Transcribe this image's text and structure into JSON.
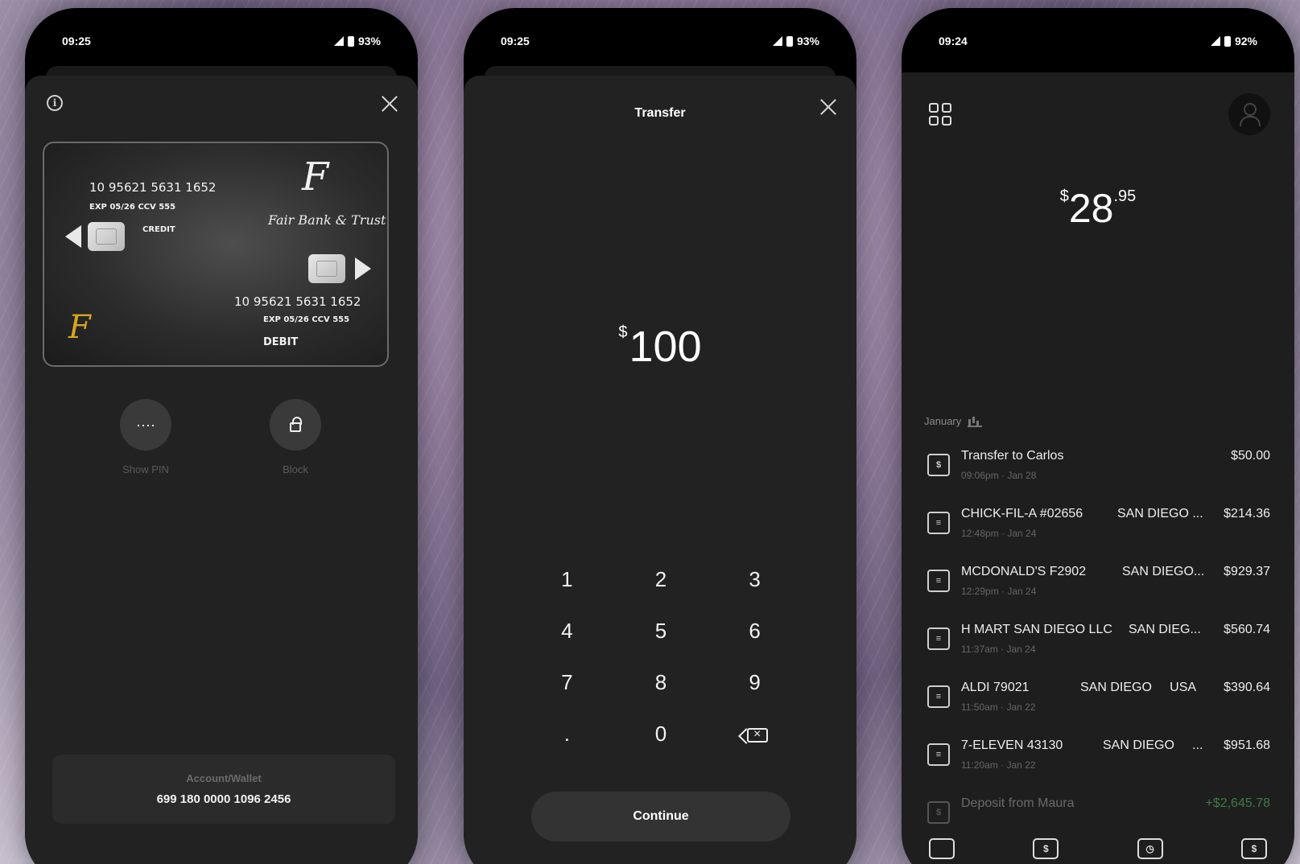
{
  "phones": [
    {
      "status": {
        "time": "09:25",
        "battery": "93%"
      }
    },
    {
      "status": {
        "time": "09:25",
        "battery": "93%"
      }
    },
    {
      "status": {
        "time": "09:24",
        "battery": "92%"
      }
    }
  ],
  "card_screen": {
    "card": {
      "credit_number": "10 95621 5631 1652",
      "credit_exp": "EXP 05/26 CCV 555",
      "credit_label": "CREDIT",
      "debit_number": "10 95621 5631 1652",
      "debit_exp": "EXP 05/26 CCV 555",
      "debit_label": "DEBIT",
      "bank_name": "Fair Bank & Trust",
      "logo_letter": "F"
    },
    "actions": [
      {
        "label": "Show PIN",
        "glyph": "····"
      },
      {
        "label": "Block"
      }
    ],
    "account": {
      "label": "Account/Wallet",
      "number": "699 180 0000 1096 2456"
    }
  },
  "transfer_screen": {
    "title": "Transfer",
    "currency": "$",
    "amount": "100",
    "keys": [
      "1",
      "2",
      "3",
      "4",
      "5",
      "6",
      "7",
      "8",
      "9",
      ".",
      "0"
    ],
    "continue_label": "Continue"
  },
  "home_screen": {
    "balance": {
      "currency": "$",
      "whole": "28",
      "cents": ".95"
    },
    "month_label": "January",
    "transactions": [
      {
        "name": "Transfer to Carlos",
        "location": "",
        "amount": "$50.00",
        "time": "09:06pm · Jan 28",
        "icon": "$"
      },
      {
        "name": "CHICK-FIL-A #02656",
        "location": "SAN DIEGO ...",
        "amount": "$214.36",
        "time": "12:48pm · Jan 24",
        "icon": "≡"
      },
      {
        "name": "MCDONALD'S F2902",
        "location": "SAN DIEGO...",
        "amount": "$929.37",
        "time": "12:29pm · Jan 24",
        "icon": "≡"
      },
      {
        "name": "H MART SAN DIEGO LLC",
        "location": "SAN DIEG...",
        "amount": "$560.74",
        "time": "11:37am · Jan 24",
        "icon": "≡"
      },
      {
        "name": "ALDI 79021",
        "location": "SAN DIEGO     USA",
        "amount": "$390.64",
        "time": "11:50am · Jan 22",
        "icon": "≡"
      },
      {
        "name": "7-ELEVEN 43130",
        "location": "SAN DIEGO     ...",
        "amount": "$951.68",
        "time": "11:20am · Jan 22",
        "icon": "≡"
      },
      {
        "name": "Deposit from Maura",
        "location": "",
        "amount": "+$2,645.78",
        "time": "",
        "icon": "$"
      }
    ],
    "nav": [
      "card",
      "$",
      "◷",
      "$"
    ]
  }
}
